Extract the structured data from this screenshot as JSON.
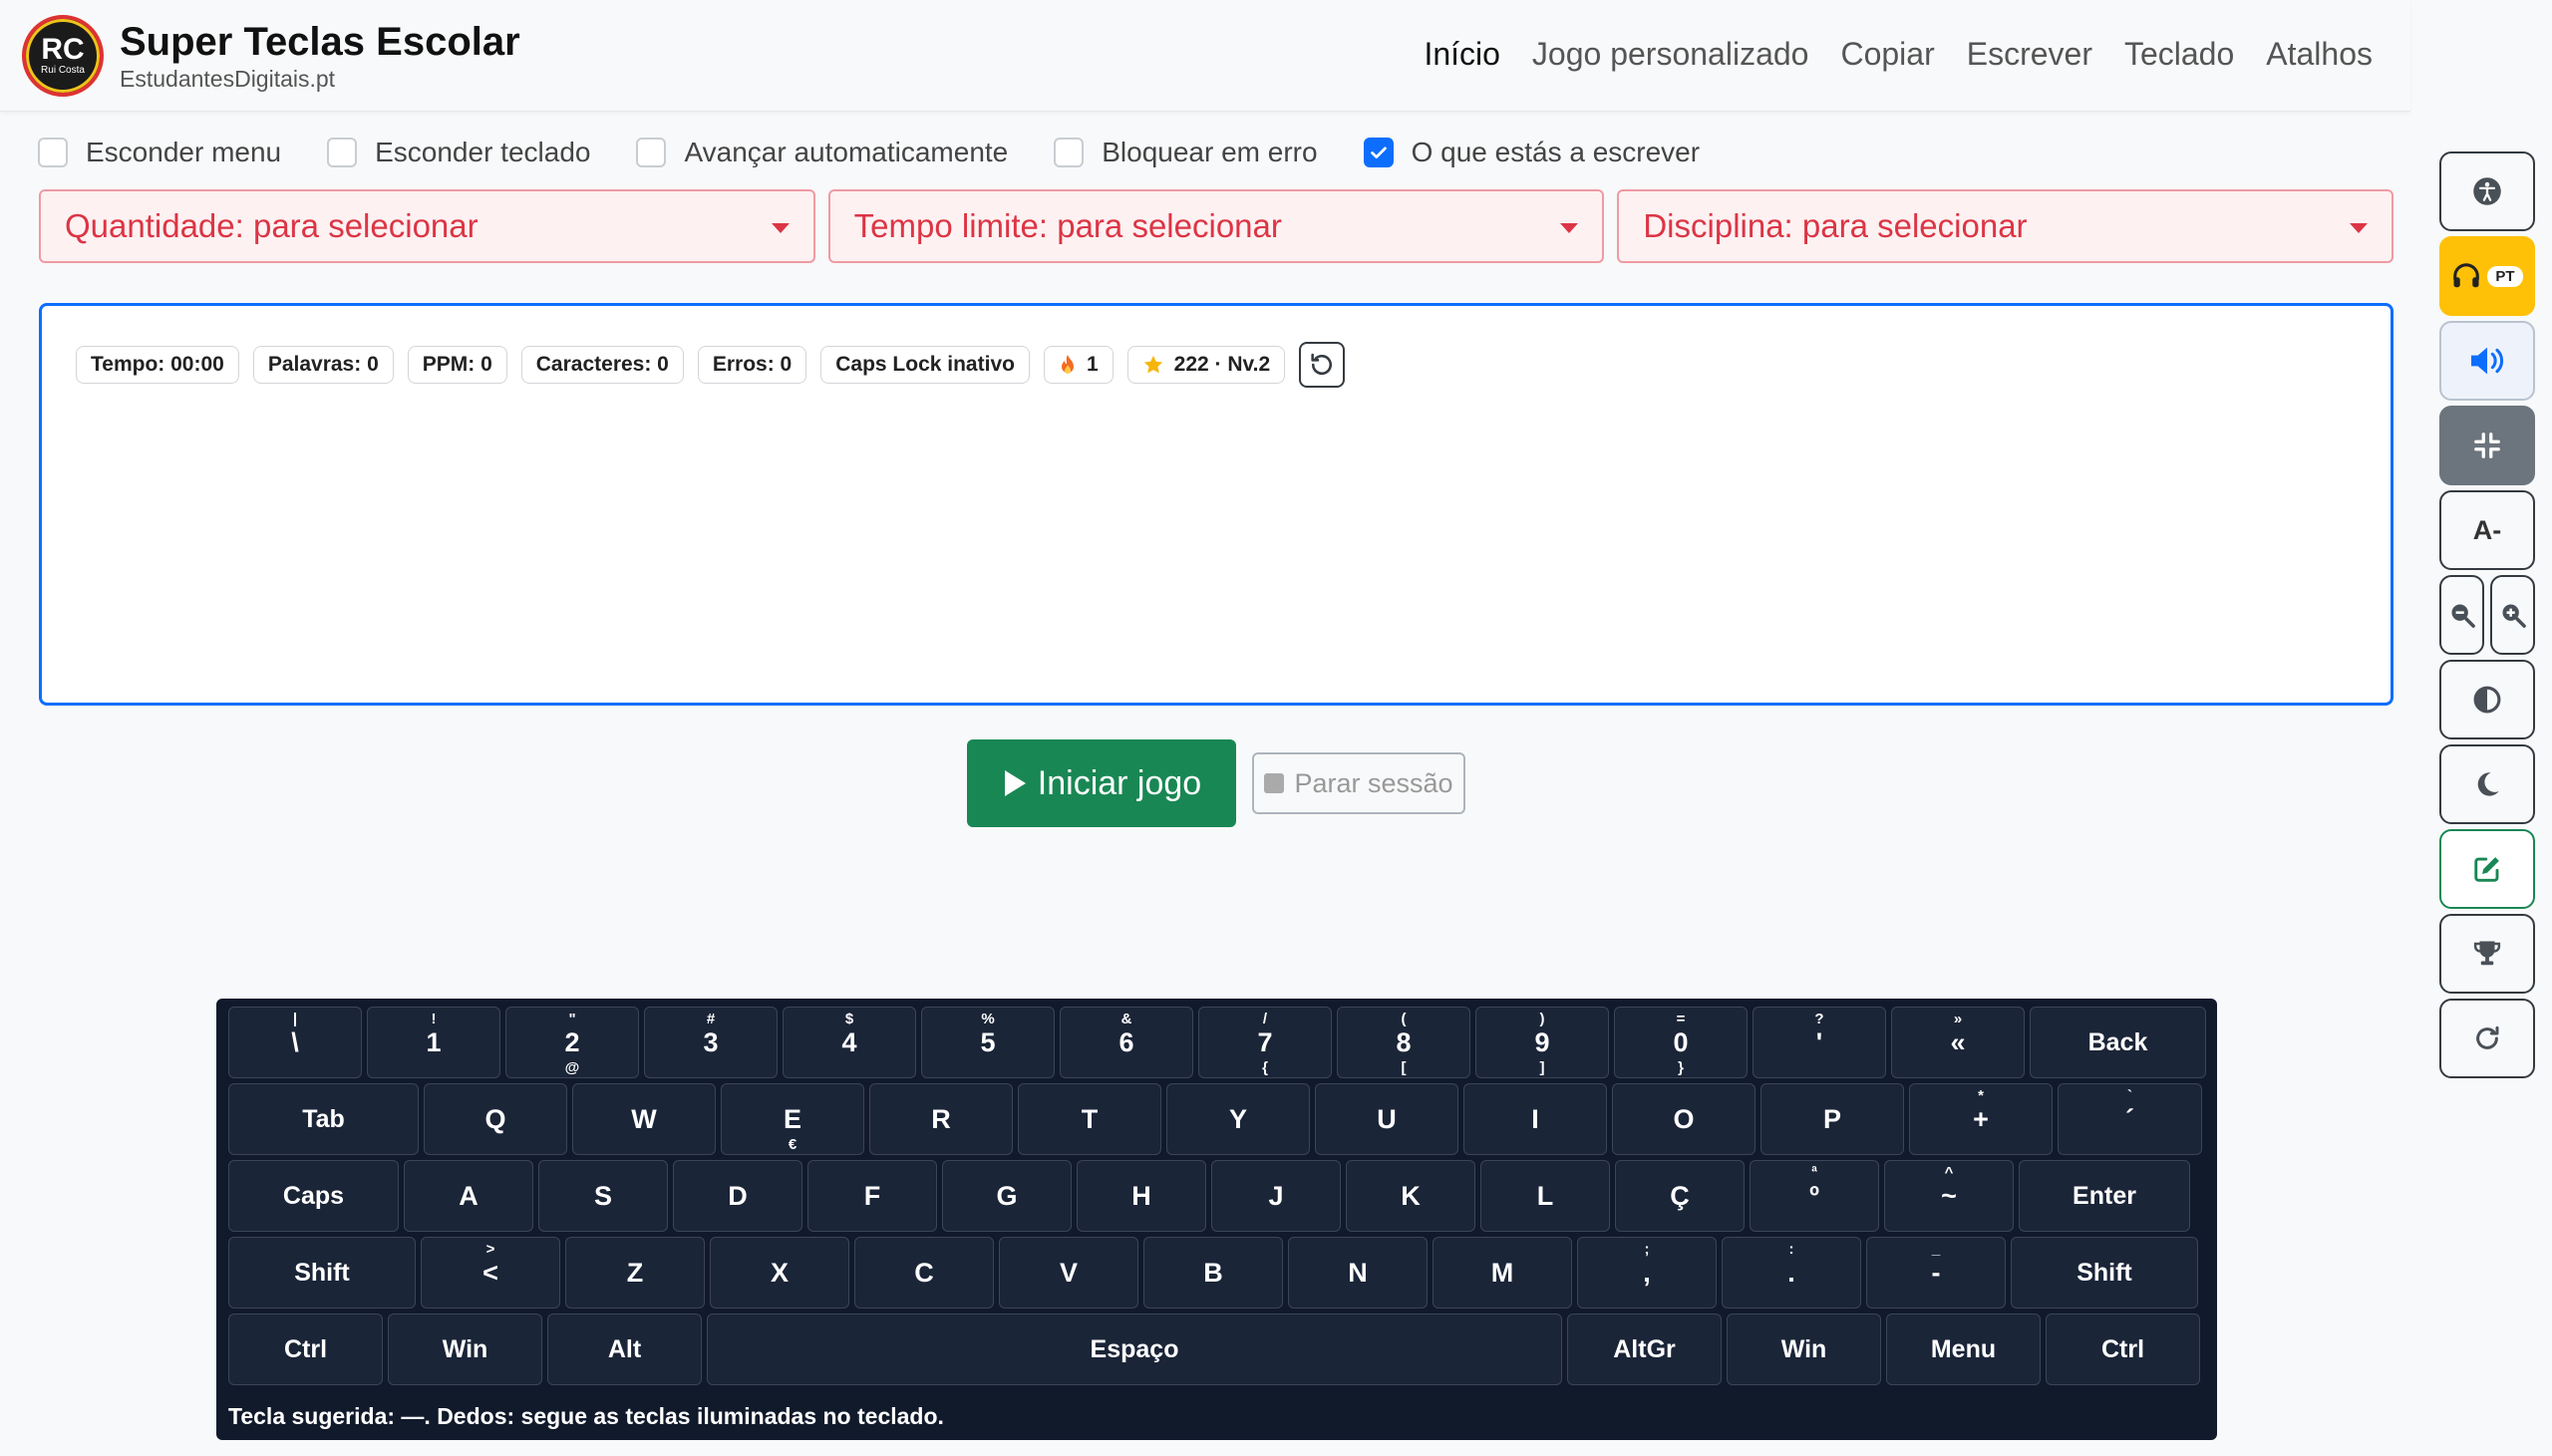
{
  "header": {
    "logo_initials": "RC",
    "logo_name": "Rui Costa",
    "title": "Super Teclas Escolar",
    "subtitle": "EstudantesDigitais.pt",
    "nav": [
      {
        "label": "Início",
        "active": true
      },
      {
        "label": "Jogo personalizado"
      },
      {
        "label": "Copiar"
      },
      {
        "label": "Escrever"
      },
      {
        "label": "Teclado"
      },
      {
        "label": "Atalhos"
      }
    ]
  },
  "options": [
    {
      "label": "Esconder menu",
      "checked": false
    },
    {
      "label": "Esconder teclado",
      "checked": false
    },
    {
      "label": "Avançar automaticamente",
      "checked": false
    },
    {
      "label": "Bloquear em erro",
      "checked": false
    },
    {
      "label": "O que estás a escrever",
      "checked": true
    }
  ],
  "selects": [
    {
      "value": "Quantidade: para selecionar"
    },
    {
      "value": "Tempo limite: para selecionar"
    },
    {
      "value": "Disciplina: para selecionar"
    }
  ],
  "stats": {
    "tempo": "Tempo: 00:00",
    "palavras": "Palavras: 0",
    "ppm": "PPM: 0",
    "caracteres": "Caracteres: 0",
    "erros": "Erros: 0",
    "caps": "Caps Lock inativo",
    "streak": "1",
    "level": "222 · Nv.2"
  },
  "buttons": {
    "start": "Iniciar jogo",
    "stop": "Parar sessão"
  },
  "keyboard": {
    "rows": [
      [
        {
          "m": "\\",
          "t": "|"
        },
        {
          "m": "1",
          "t": "!"
        },
        {
          "m": "2",
          "t": "\"",
          "b": "@"
        },
        {
          "m": "3",
          "t": "#"
        },
        {
          "m": "4",
          "t": "$"
        },
        {
          "m": "5",
          "t": "%"
        },
        {
          "m": "6",
          "t": "&"
        },
        {
          "m": "7",
          "t": "/",
          "b": "{"
        },
        {
          "m": "8",
          "t": "(",
          "b": "["
        },
        {
          "m": "9",
          "t": ")",
          "b": "]"
        },
        {
          "m": "0",
          "t": "=",
          "b": "}"
        },
        {
          "m": "'",
          "t": "?"
        },
        {
          "m": "«",
          "t": "»"
        },
        {
          "m": "Back"
        }
      ],
      [
        {
          "m": "Tab"
        },
        {
          "m": "Q"
        },
        {
          "m": "W"
        },
        {
          "m": "E",
          "b": "€"
        },
        {
          "m": "R"
        },
        {
          "m": "T"
        },
        {
          "m": "Y"
        },
        {
          "m": "U"
        },
        {
          "m": "I"
        },
        {
          "m": "O"
        },
        {
          "m": "P"
        },
        {
          "m": "+",
          "t": "*"
        },
        {
          "m": "´",
          "t": "`"
        }
      ],
      [
        {
          "m": "Caps"
        },
        {
          "m": "A"
        },
        {
          "m": "S"
        },
        {
          "m": "D"
        },
        {
          "m": "F"
        },
        {
          "m": "G"
        },
        {
          "m": "H"
        },
        {
          "m": "J"
        },
        {
          "m": "K"
        },
        {
          "m": "L"
        },
        {
          "m": "Ç"
        },
        {
          "m": "º",
          "t": "ª"
        },
        {
          "m": "~",
          "t": "^"
        },
        {
          "m": "Enter"
        }
      ],
      [
        {
          "m": "Shift"
        },
        {
          "m": "<",
          "t": ">"
        },
        {
          "m": "Z"
        },
        {
          "m": "X"
        },
        {
          "m": "C"
        },
        {
          "m": "V"
        },
        {
          "m": "B"
        },
        {
          "m": "N"
        },
        {
          "m": "M"
        },
        {
          "m": ",",
          "t": ";"
        },
        {
          "m": ".",
          "t": ":"
        },
        {
          "m": "-",
          "t": "_"
        },
        {
          "m": "Shift"
        }
      ],
      [
        {
          "m": "Ctrl"
        },
        {
          "m": "Win"
        },
        {
          "m": "Alt"
        },
        {
          "m": "Espaço"
        },
        {
          "m": "AltGr"
        },
        {
          "m": "Win"
        },
        {
          "m": "Menu"
        },
        {
          "m": "Ctrl"
        }
      ]
    ],
    "hint": "Tecla sugerida: —. Dedos: segue as teclas iluminadas no teclado."
  },
  "sidebar": {
    "language_badge": "PT",
    "font_decrease_label": "A-",
    "icons": [
      "accessibility-icon",
      "headphones-icon",
      "volume-icon",
      "compress-icon",
      "font-decrease-icon",
      "zoom-out-icon",
      "zoom-in-icon",
      "contrast-icon",
      "moon-icon",
      "edit-icon",
      "trophy-icon",
      "redo-icon"
    ]
  },
  "colors": {
    "primary": "#0d6efd",
    "success": "#198754",
    "danger": "#dc3545",
    "warning": "#ffc107",
    "keyboard_bg": "#111a2b",
    "key_bg": "#1b2538"
  }
}
